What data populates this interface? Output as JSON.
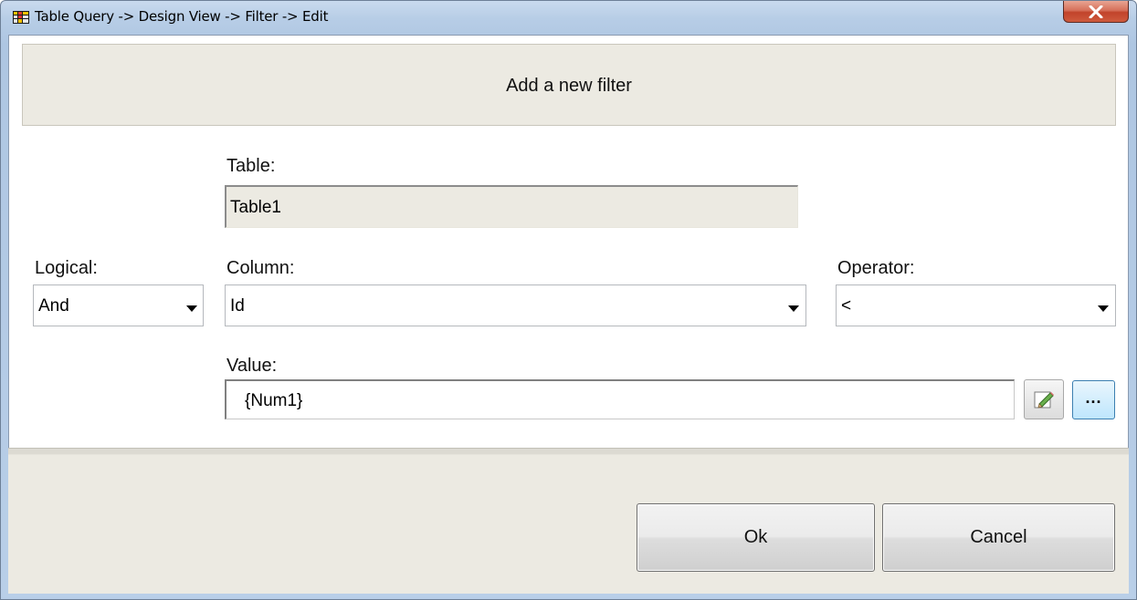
{
  "window": {
    "title": "Table Query -> Design View -> Filter -> Edit"
  },
  "header": {
    "title": "Add a new filter"
  },
  "form": {
    "table": {
      "label": "Table:",
      "value": "Table1"
    },
    "logical": {
      "label": "Logical:",
      "value": "And"
    },
    "column": {
      "label": "Column:",
      "value": "Id"
    },
    "operator": {
      "label": "Operator:",
      "value": "<"
    },
    "value": {
      "label": "Value:",
      "value": "{Num1}"
    },
    "browse_button_label": "..."
  },
  "footer": {
    "ok_label": "Ok",
    "cancel_label": "Cancel"
  },
  "icons": {
    "app": "table-query-icon",
    "close": "close-icon",
    "edit": "pencil-edit-icon",
    "dropdown": "chevron-down-icon"
  },
  "colors": {
    "close_button": "#c94a30",
    "panel_background": "#eceae2",
    "title_bar": "#b9cfe8"
  }
}
